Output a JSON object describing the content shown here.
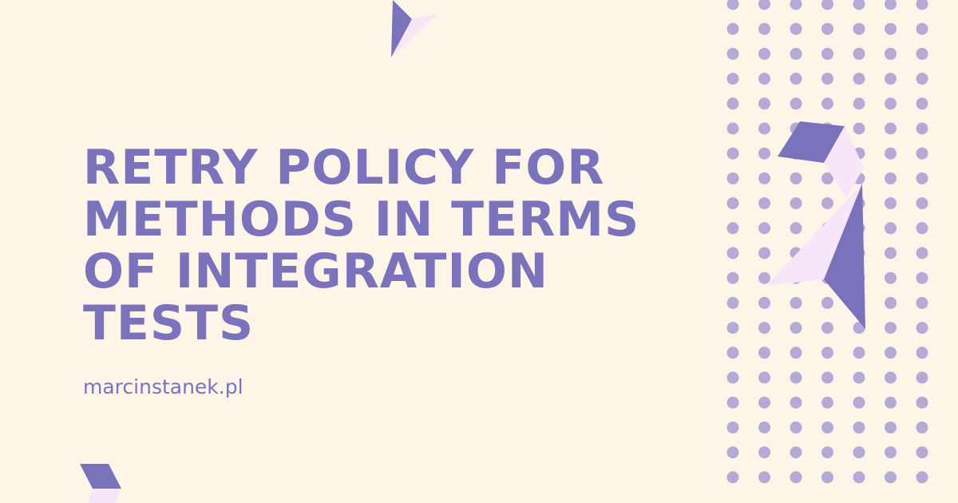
{
  "title_lines": [
    "RETRY POLICY FOR",
    "METHODS IN TERMS",
    "OF INTEGRATION",
    "TESTS"
  ],
  "site": "marcinstanek.pl",
  "colors": {
    "background": "#FDF6E8",
    "accent": "#7B72BC",
    "dot": "#B5A9D6",
    "shape_light": "#F7E6F8"
  }
}
